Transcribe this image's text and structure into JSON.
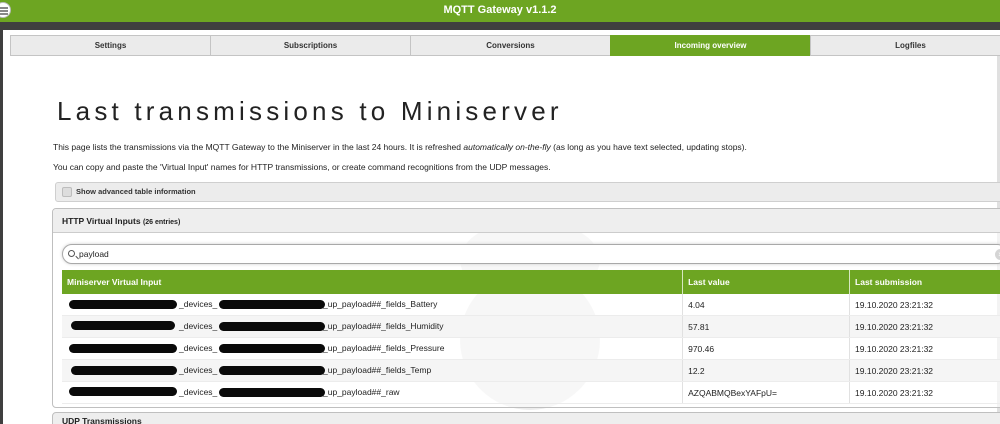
{
  "app": {
    "title": "MQTT Gateway v1.1.2"
  },
  "tabs": [
    {
      "label": "Settings"
    },
    {
      "label": "Subscriptions"
    },
    {
      "label": "Conversions"
    },
    {
      "label": "Incoming overview"
    },
    {
      "label": "Logfiles"
    }
  ],
  "active_tab": "Incoming overview",
  "page": {
    "title": "Last transmissions to Miniserver",
    "intro_1_a": "This page lists the transmissions via the MQTT Gateway to the Miniserver in the last 24 hours. It is refreshed ",
    "intro_1_em": "automatically on-the-fly",
    "intro_1_b": " (as long as you have text selected, updating stops).",
    "intro_2": "You can copy and paste the 'Virtual Input' names for HTTP transmissions, or create command recognitions from the UDP messages."
  },
  "advanced": {
    "label": "Show advanced table information",
    "checked": false
  },
  "http_panel": {
    "title": "HTTP Virtual Inputs",
    "count": "(26 entries)",
    "search": {
      "value": "payload",
      "placeholder": ""
    },
    "columns": [
      "Miniserver Virtual Input",
      "Last value",
      "Last submission"
    ],
    "rows": [
      {
        "mid": "_devices_",
        "suffix": "_up_payload##_fields_Battery",
        "value": "4.04",
        "time": "19.10.2020 23:21:32"
      },
      {
        "mid": "_devices_",
        "suffix": "_up_payload##_fields_Humidity",
        "value": "57.81",
        "time": "19.10.2020 23:21:32"
      },
      {
        "mid": "_devices_",
        "suffix": "_up_payload##_fields_Pressure",
        "value": "970.46",
        "time": "19.10.2020 23:21:32"
      },
      {
        "mid": "_devices_",
        "suffix": "_up_payload##_fields_Temp",
        "value": "12.2",
        "time": "19.10.2020 23:21:32"
      },
      {
        "mid": "_devices_",
        "suffix": "_up_payload##_raw",
        "value": "AZQABMQBexYAFpU=",
        "time": "19.10.2020 23:21:32"
      }
    ]
  },
  "udp_panel": {
    "title": "UDP Transmissions"
  },
  "colors": {
    "accent": "#6da522",
    "dark": "#3f3f3f"
  }
}
